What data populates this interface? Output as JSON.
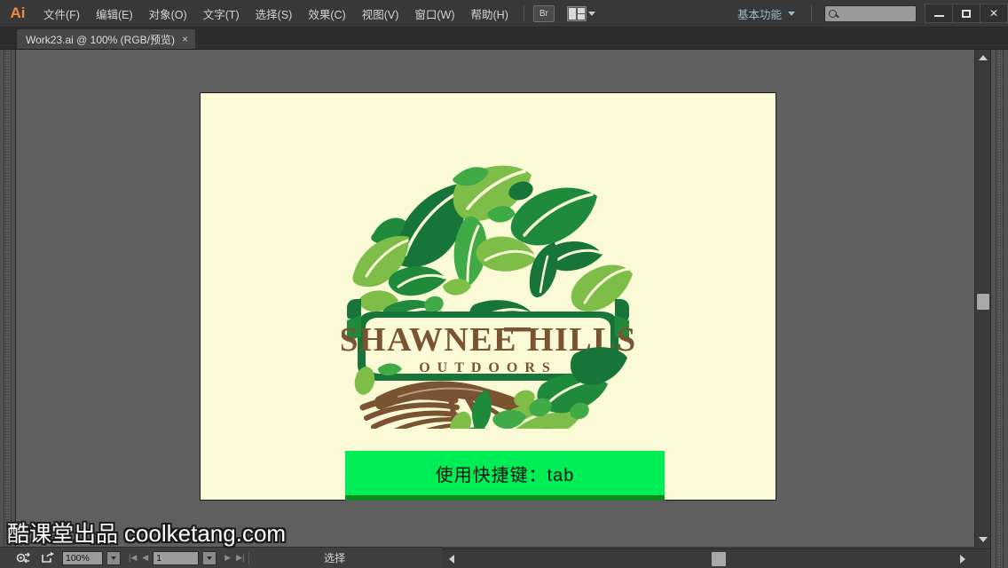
{
  "app": {
    "logo_text": "Ai",
    "title": "Adobe Illustrator"
  },
  "menubar": {
    "items": [
      {
        "label": "文件(F)"
      },
      {
        "label": "编辑(E)"
      },
      {
        "label": "对象(O)"
      },
      {
        "label": "文字(T)"
      },
      {
        "label": "选择(S)"
      },
      {
        "label": "效果(C)"
      },
      {
        "label": "视图(V)"
      },
      {
        "label": "窗口(W)"
      },
      {
        "label": "帮助(H)"
      }
    ],
    "bridge_label": "Br",
    "workspace": "基本功能",
    "search_placeholder": "",
    "search_value": "",
    "window_buttons": {
      "minimize": "—",
      "maximize": "▢",
      "close": "✕"
    }
  },
  "tabbar": {
    "tabs": [
      {
        "label": "Work23.ai @ 100% (RGB/预览)",
        "close": "×",
        "active": true
      }
    ]
  },
  "artboard": {
    "background_color": "#fafad7",
    "logo": {
      "brand_line1": "SHAWNEE HILLS",
      "brand_line2": "OUTDOORS",
      "colors": {
        "brown": "#7a5430",
        "dark_green": "#1f8a3c",
        "mid_green": "#3faa46",
        "light_green": "#7dbd48",
        "deep_green": "#17753a",
        "cream": "#fafad7"
      }
    },
    "callout": {
      "text": "使用快捷键：tab",
      "fill_color": "#00ee55",
      "shadow_color": "#0a8a21",
      "text_color": "#111111"
    }
  },
  "statusbar": {
    "zoom_value": "100%",
    "page_value": "1",
    "status_text": "选择",
    "settings_icon": "gear-icon",
    "share_icon": "share-icon",
    "nav_first": "|◀",
    "nav_prev": "◀",
    "nav_next": "▶",
    "nav_last": "▶|"
  },
  "watermark": {
    "cn": "酷课堂出品",
    "en": "coolketang.com"
  }
}
